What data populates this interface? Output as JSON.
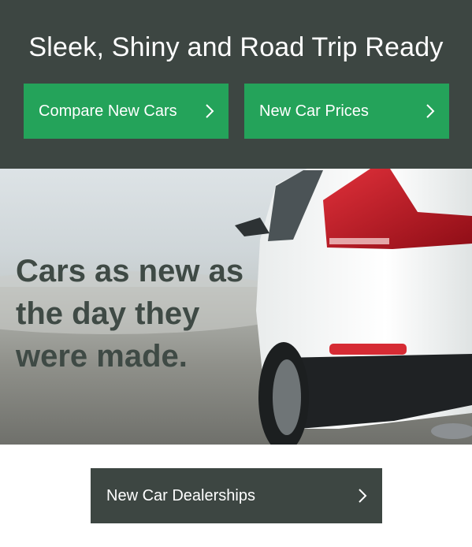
{
  "header": {
    "headline": "Sleek, Shiny and Road Trip Ready",
    "buttons": [
      {
        "label": "Compare New Cars",
        "icon": "chevron-right-icon"
      },
      {
        "label": "New Car Prices",
        "icon": "chevron-right-icon"
      }
    ]
  },
  "hero": {
    "tagline": "Cars as new as the day they were made."
  },
  "footer_button": {
    "label": "New Car Dealerships",
    "icon": "chevron-right-icon"
  },
  "colors": {
    "header_bg": "#3d4642",
    "accent_green": "#24a35a",
    "tagline_text": "#3f4a45"
  }
}
